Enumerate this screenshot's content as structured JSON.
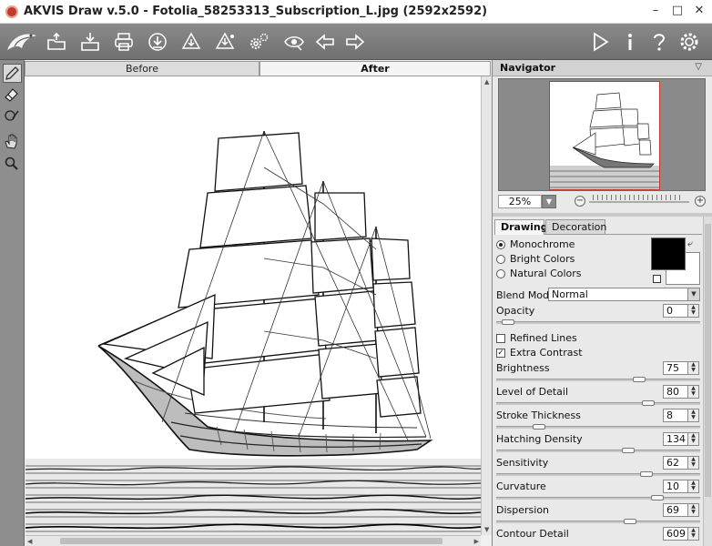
{
  "window": {
    "title": "AKVIS Draw v.5.0 - Fotolia_58253313_Subscription_L.jpg (2592x2592)",
    "minimize": "–",
    "maximize": "□",
    "close": "✕"
  },
  "toolbar": {
    "left_icons": [
      "akvis-logo-icon",
      "open-icon",
      "save-icon",
      "print-icon",
      "share-icon",
      "batch-icon",
      "import-icon",
      "settings-gear-icon",
      "preview-eye-icon",
      "undo-arrow-icon",
      "redo-arrow-icon"
    ],
    "right_icons": [
      "run-play-icon",
      "info-icon",
      "help-icon",
      "preferences-gear-icon"
    ]
  },
  "left_tools": [
    "pencil-icon",
    "eraser-icon",
    "history-brush-icon",
    "hand-icon",
    "zoom-icon"
  ],
  "canvas": {
    "tabs": {
      "before": "Before",
      "after": "After"
    }
  },
  "navigator": {
    "title": "Navigator",
    "zoom": "25%",
    "zoom_minus": "−",
    "zoom_plus": "+"
  },
  "panel": {
    "tabs": {
      "drawing": "Drawing",
      "decoration": "Decoration"
    },
    "mode_options": [
      "Monochrome",
      "Bright Colors",
      "Natural Colors"
    ],
    "selected_mode": "Monochrome",
    "colors": {
      "foreground": "#000000",
      "background": "#ffffff"
    },
    "blend_mode_label": "Blend Mode",
    "blend_mode_value": "Normal",
    "opacity": {
      "label": "Opacity",
      "value": "0"
    },
    "refined_lines": {
      "label": "Refined Lines",
      "checked": false,
      "mark": ""
    },
    "extra_contrast": {
      "label": "Extra Contrast",
      "checked": true,
      "mark": "✓"
    },
    "params": [
      {
        "label": "Brightness",
        "value": "75"
      },
      {
        "label": "Level of Detail",
        "value": "80"
      },
      {
        "label": "Stroke Thickness",
        "value": "8"
      },
      {
        "label": "Hatching Density",
        "value": "134"
      },
      {
        "label": "Sensitivity",
        "value": "62"
      },
      {
        "label": "Curvature",
        "value": "10"
      },
      {
        "label": "Dispersion",
        "value": "69"
      },
      {
        "label": "Contour Detail",
        "value": "609"
      }
    ]
  }
}
